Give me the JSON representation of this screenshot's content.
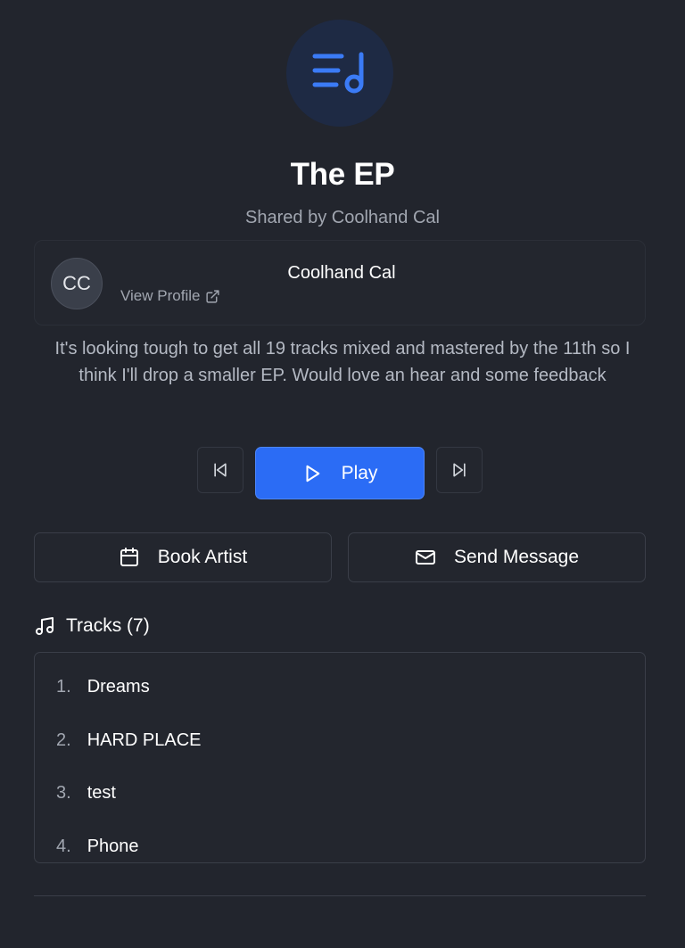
{
  "playlist": {
    "title": "The EP",
    "shared_by": "Shared by Coolhand Cal",
    "logo_icon": "playlist-music-icon",
    "accent_color": "#2b6cf5"
  },
  "artist": {
    "initials": "CC",
    "name": "Coolhand Cal",
    "view_profile_label": "View Profile",
    "view_profile_icon": "external-link-icon"
  },
  "description": "It's looking tough to get all 19 tracks mixed and mastered by the 11th so I think I'll drop a smaller EP. Would love an hear and some feedback",
  "player": {
    "prev_icon": "skip-back-icon",
    "play_label": "Play",
    "play_icon": "play-icon",
    "next_icon": "skip-forward-icon"
  },
  "actions": {
    "book_label": "Book Artist",
    "book_icon": "calendar-icon",
    "message_label": "Send Message",
    "message_icon": "mail-icon"
  },
  "tracks": {
    "header": "Tracks (7)",
    "header_icon": "music-notes-icon",
    "items": [
      {
        "num": "1.",
        "title": "Dreams"
      },
      {
        "num": "2.",
        "title": "HARD PLACE"
      },
      {
        "num": "3.",
        "title": "test"
      },
      {
        "num": "4.",
        "title": "Phone"
      }
    ]
  }
}
